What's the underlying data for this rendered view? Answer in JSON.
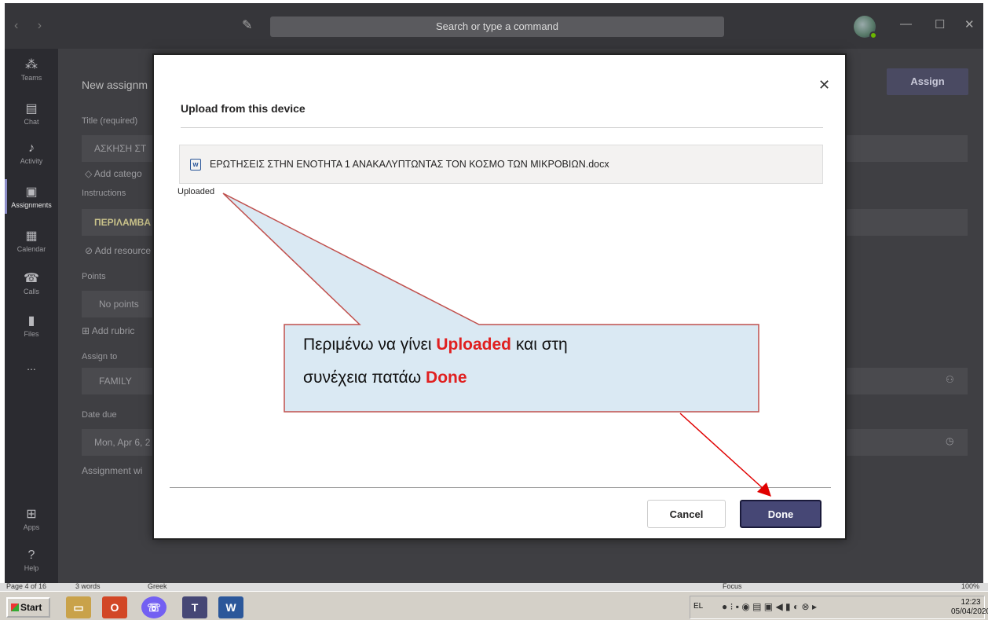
{
  "titlebar": {
    "search_placeholder": "Search or type a command"
  },
  "rail": {
    "items": [
      {
        "label": "Teams",
        "icon": "teams-icon"
      },
      {
        "label": "Chat",
        "icon": "chat-icon"
      },
      {
        "label": "Activity",
        "icon": "bell-icon"
      },
      {
        "label": "Assignments",
        "icon": "assignments-icon"
      },
      {
        "label": "Calendar",
        "icon": "calendar-icon"
      },
      {
        "label": "Calls",
        "icon": "phone-icon"
      },
      {
        "label": "Files",
        "icon": "file-icon"
      },
      {
        "label": "Apps",
        "icon": "apps-icon"
      },
      {
        "label": "Help",
        "icon": "help-icon"
      }
    ],
    "more": "..."
  },
  "form": {
    "heading": "New assignm",
    "title_label": "Title (required)",
    "title_value": "ΑΣΚΗΣΗ ΣΤ",
    "add_category": "Add catego",
    "instructions_label": "Instructions",
    "instructions_value": "ΠΕΡΙΛΑΜΒΑ",
    "add_resources": "Add resource",
    "points_label": "Points",
    "points_value": "No points",
    "add_rubric": "Add rubric",
    "assign_to_label": "Assign to",
    "assign_to_value": "FAMILY",
    "date_due_label": "Date due",
    "date_due_value": "Mon, Apr 6, 2",
    "assignment_note": "Assignment wi",
    "assign_button": "Assign"
  },
  "dialog": {
    "title": "Upload from this device",
    "file_name": "ΕΡΩΤΗΣΕΙΣ ΣΤΗΝ ΕΝΟΤΗΤΑ 1 ΑΝΑΚΑΛΥΠΤΩΝΤΑΣ ΤΟΝ ΚΟΣΜΟ ΤΩΝ ΜΙΚΡΟΒΙΩΝ.docx",
    "status": "Uploaded",
    "cancel_label": "Cancel",
    "done_label": "Done"
  },
  "callout": {
    "line1_prefix": "Περιμένω να γίνει ",
    "line1_highlight": "Uploaded",
    "line1_suffix": " και στη",
    "line2_prefix": "συνέχεια πατάω ",
    "line2_highlight": "Done",
    "highlight_color": "#e02020"
  },
  "word_status": {
    "page": "Page 4 of 16",
    "words": "3 words",
    "language": "Greek",
    "focus": "Focus",
    "zoom": "100%"
  },
  "taskbar": {
    "start_label": "Start",
    "language": "EL",
    "time": "12:23",
    "date": "05/04/2020"
  },
  "colors": {
    "accent": "#464775",
    "teams_dark": "#36363a",
    "arrow": "#e00000"
  }
}
